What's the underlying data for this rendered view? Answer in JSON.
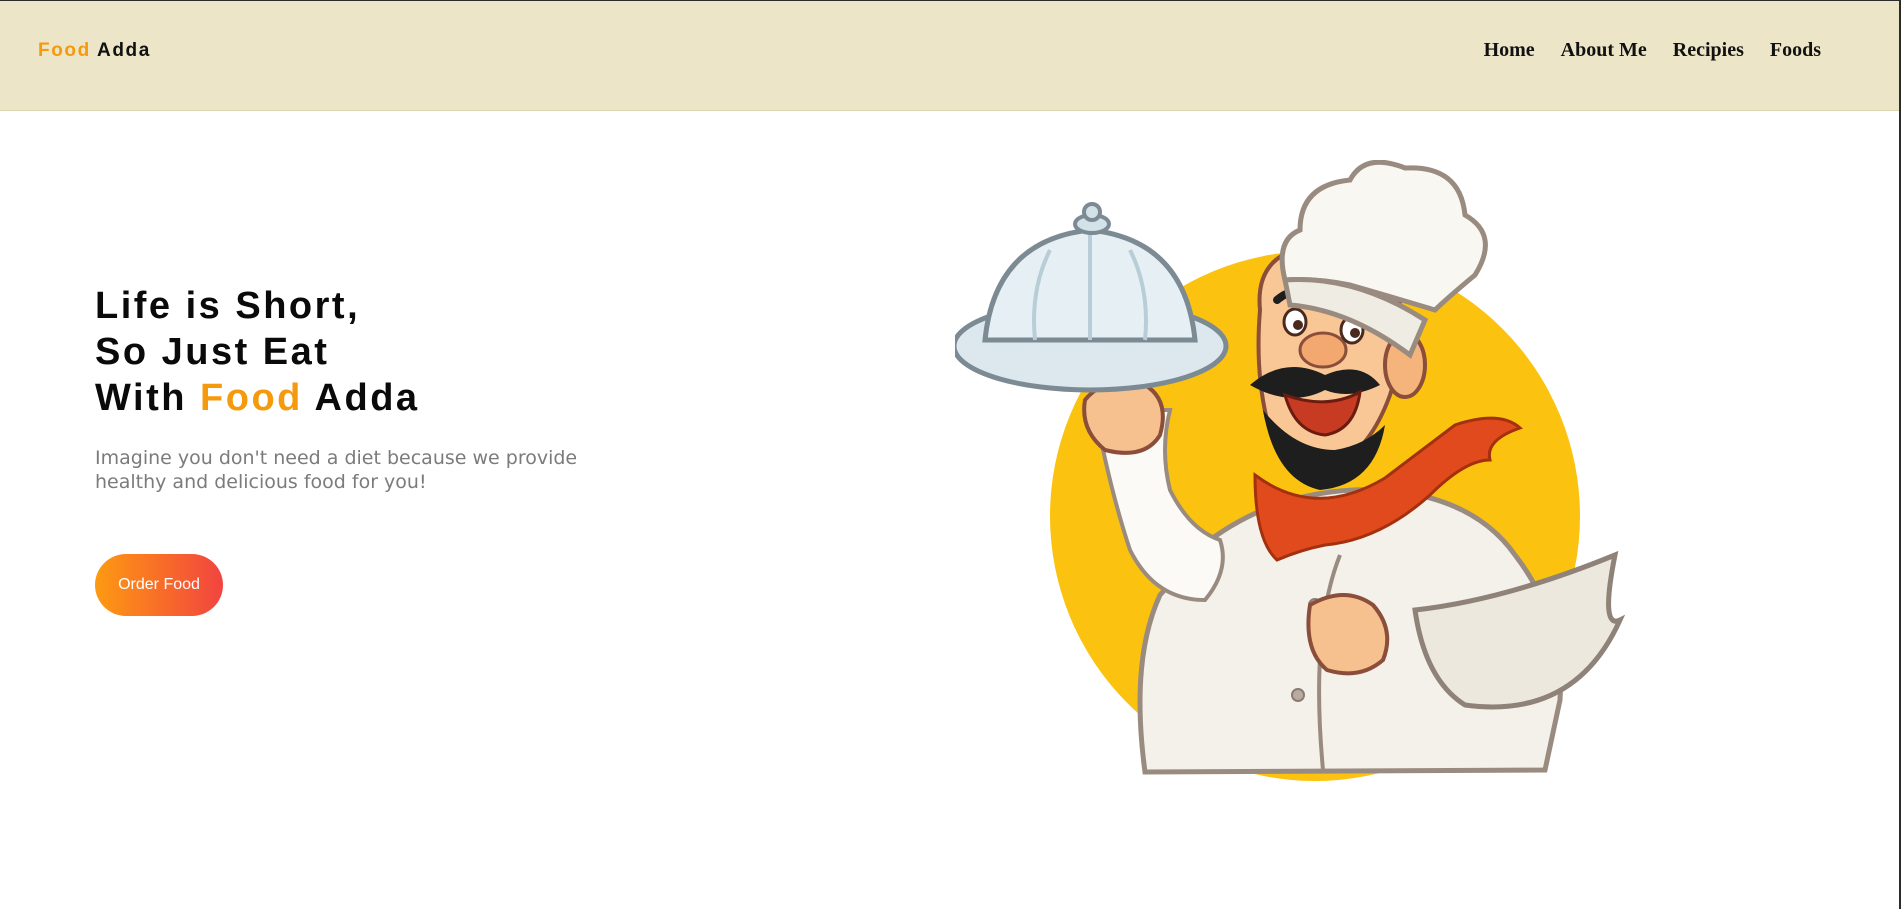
{
  "nav": {
    "logo": {
      "accent": "Food",
      "rest": "Adda"
    },
    "links": [
      "Home",
      "About Me",
      "Recipies",
      "Foods"
    ]
  },
  "hero": {
    "line1": "Life is Short,",
    "line2": "So Just Eat",
    "line3_prefix": "With",
    "line3_accent": "Food",
    "line3_suffix": "Adda",
    "subtitle": "Imagine you don't need a diet because we provide healthy and delicious food for you!",
    "button_label": "Order Food"
  },
  "colors": {
    "accent": "#f59a0c",
    "navbar_bg": "#ede5c8",
    "button_gradient": [
      "#fd9a12",
      "#f1443f"
    ],
    "illustration_circle": "#fbc30f"
  },
  "icons": [
    "chef-illustration"
  ]
}
